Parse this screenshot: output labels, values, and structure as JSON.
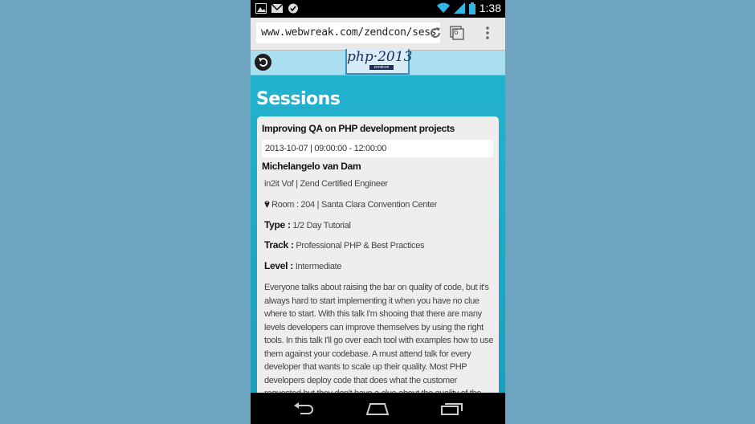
{
  "status_bar": {
    "time": "1:38",
    "icons": [
      "image-notification-icon",
      "gmail-notification-icon",
      "check-notification-icon",
      "wifi-icon",
      "signal-icon",
      "battery-icon"
    ]
  },
  "browser": {
    "url": "www.webwreak.com/zendcon/sess",
    "tab_count": "6"
  },
  "site": {
    "logo_text": "php·2013",
    "logo_sub": "zendcon",
    "heading": "Sessions"
  },
  "session": {
    "title": "Improving QA on PHP development projects",
    "datetime": "2013-10-07 | 09:00:00 - 12:00:00",
    "speaker": "Michelangelo van Dam",
    "affiliation": "in2it Vof | Zend Certified Engineer",
    "room": "Room : 204 | Santa Clara Convention Center",
    "type_label": "Type :",
    "type_value": "1/2 Day Tutorial",
    "track_label": "Track :",
    "track_value": "Professional PHP & Best Practices",
    "level_label": "Level :",
    "level_value": "Intermediate",
    "description": "Everyone talks about raising the bar on quality of code, but it's always hard to start implementing it when you have no clue where to start. With this talk I'm shooing that there are many levels developers can improve themselves by using the right tools. In this talk I'll go over each tool with examples how to use them against your codebase. A must attend talk for every developer that wants to scale up their quality. Most PHP developers deploy code that does what the customer requested but they don't have a clue about the quality of the product they deliver. Without this knowledge, maintenance can be a hell and"
  },
  "colors": {
    "background": "#6ea4bf",
    "page_accent": "#1da9c7",
    "header": "#aadff2"
  }
}
